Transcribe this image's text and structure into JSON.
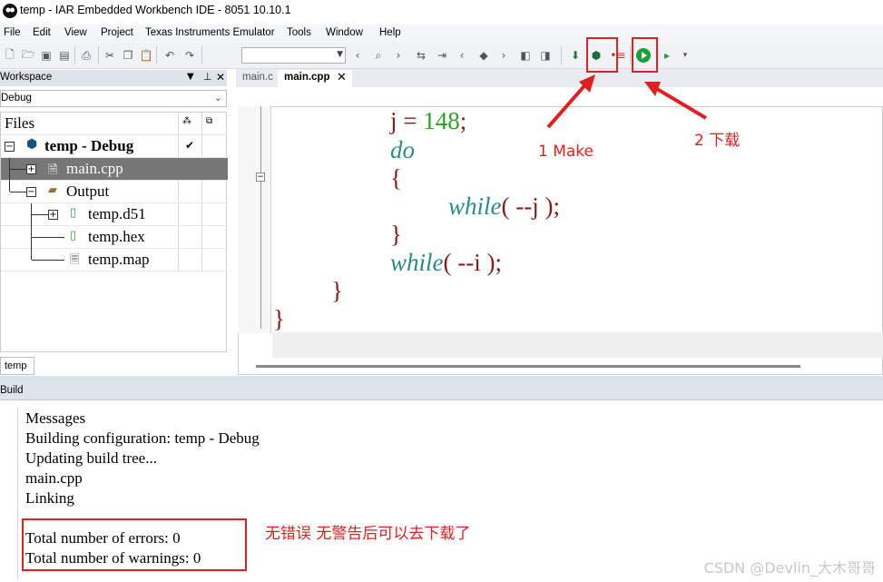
{
  "window": {
    "title": "temp - IAR Embedded Workbench IDE - 8051 10.10.1"
  },
  "menu": [
    "File",
    "Edit",
    "View",
    "Project",
    "Texas Instruments Emulator",
    "Tools",
    "Window",
    "Help"
  ],
  "workspace": {
    "header": "Workspace",
    "config": "Debug",
    "files_label": "Files",
    "project": "temp - Debug",
    "items": [
      "main.cpp",
      "Output",
      "temp.d51",
      "temp.hex",
      "temp.map"
    ],
    "tab": "temp"
  },
  "editor": {
    "tabs": [
      "main.c",
      "main.cpp"
    ],
    "code": {
      "l1_var": "j = ",
      "l1_num": "148",
      "l1_end": ";",
      "l2": "do",
      "l3": "{",
      "l4_kw": "while",
      "l4_rest": "( --j );",
      "l5": "}",
      "l6_kw": "while",
      "l6_rest": "( --i );",
      "l7": "}",
      "l8": "}"
    }
  },
  "build": {
    "header": "Build",
    "lines": [
      "Messages",
      "Building configuration: temp - Debug",
      "Updating build tree...",
      "main.cpp",
      "Linking",
      "Total number of errors: 0",
      "Total number of warnings: 0"
    ]
  },
  "annotations": {
    "make": "1 Make",
    "download": "2 下载",
    "note": "无错误 无警告后可以去下载了"
  },
  "watermark": "CSDN @Devlin_大木哥哥",
  "colors": {
    "annotation": "#e02020",
    "keyword": "#2a8a8a",
    "code": "#8b1a1a",
    "number": "#2aa02a"
  }
}
